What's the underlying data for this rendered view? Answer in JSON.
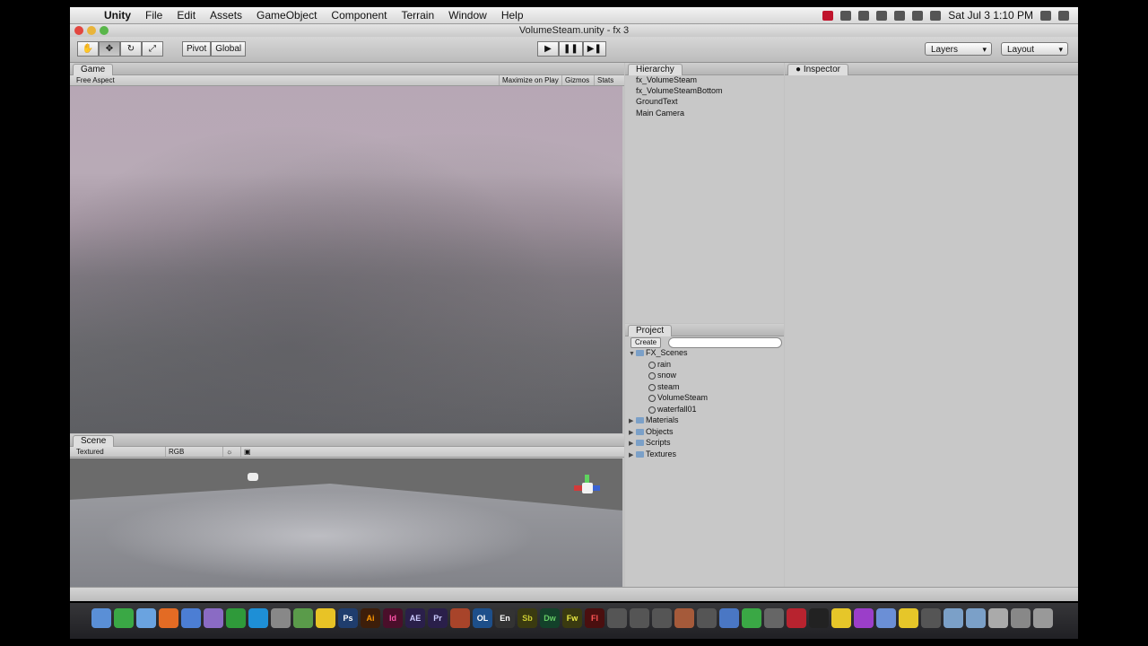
{
  "menubar": {
    "app": "Unity",
    "items": [
      "File",
      "Edit",
      "Assets",
      "GameObject",
      "Component",
      "Terrain",
      "Window",
      "Help"
    ],
    "clock": "Sat Jul 3  1:10 PM"
  },
  "window": {
    "title": "VolumeSteam.unity - fx 3"
  },
  "toolbar": {
    "pivot": "Pivot",
    "global": "Global",
    "layers": "Layers",
    "layout": "Layout"
  },
  "game": {
    "tab": "Game",
    "aspect": "Free Aspect",
    "maximize": "Maximize on Play",
    "gizmos": "Gizmos",
    "stats": "Stats"
  },
  "scene": {
    "tab": "Scene",
    "draw_mode": "Textured",
    "render_mode": "RGB"
  },
  "hierarchy": {
    "tab": "Hierarchy",
    "items": [
      "fx_VolumeSteam",
      "fx_VolumeSteamBottom",
      "GroundText",
      "Main Camera"
    ]
  },
  "project": {
    "tab": "Project",
    "create": "Create",
    "root": "FX_Scenes",
    "scenes": [
      "rain",
      "snow",
      "steam",
      "VolumeSteam",
      "waterfall01"
    ],
    "folders": [
      "Materials",
      "Objects",
      "Scripts",
      "Textures"
    ]
  },
  "inspector": {
    "tab": "Inspector"
  },
  "dock": {
    "labels": [
      "Ps",
      "Ai",
      "Id",
      "AE",
      "Pr",
      "OL",
      "En",
      "Sb",
      "Dw",
      "Fw",
      "Fl"
    ]
  }
}
